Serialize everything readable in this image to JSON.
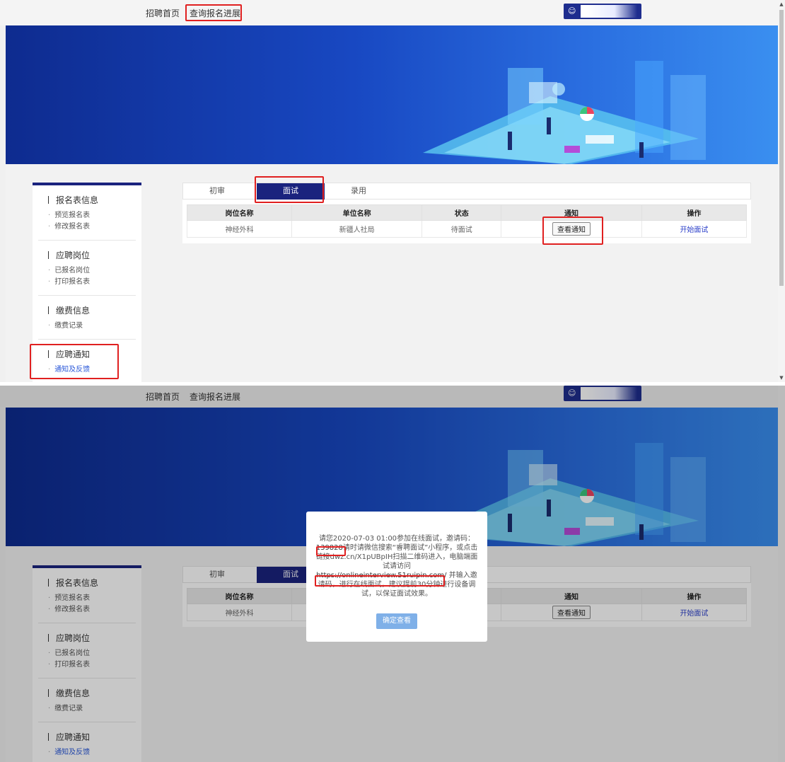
{
  "nav": {
    "home": "招聘首页",
    "query": "查询报名进展"
  },
  "sidebar": {
    "sections": [
      {
        "title": "报名表信息",
        "items": [
          "预览报名表",
          "修改报名表"
        ]
      },
      {
        "title": "应聘岗位",
        "items": [
          "已报名岗位",
          "打印报名表"
        ]
      },
      {
        "title": "缴费信息",
        "items": [
          "缴费记录"
        ]
      },
      {
        "title": "应聘通知",
        "items": [
          "通知及反馈"
        ]
      }
    ]
  },
  "tabs": [
    "初审",
    "面试",
    "录用"
  ],
  "table": {
    "headers": [
      "岗位名称",
      "单位名称",
      "状态",
      "通知",
      "操作"
    ],
    "row": {
      "position": "神经外科",
      "unit": "新疆人社局",
      "status": "待面试",
      "notice_btn": "查看通知",
      "action": "开始面试"
    }
  },
  "modal": {
    "line1": "请您2020-07-03 01:00参加在线面试，邀请码：",
    "code": "139828",
    "line2": "请时请微信搜索“睿聘面试”小程序，或点击链接dwz.cn/X1pUBpIH扫描二维码进入，电脑端面试请访问",
    "url": "https://onlineinterview.51ruipin.com/",
    "line3": "并输入邀请码，进行在线面试，建议提前30分钟进行设备调试，以保证面试效果。",
    "confirm": "确定查看"
  },
  "colors": {
    "brand": "#1a237e",
    "banner_start": "#0e2b8f",
    "banner_end": "#3a8ff0",
    "highlight": "#e02020",
    "link": "#2b3fc9"
  }
}
